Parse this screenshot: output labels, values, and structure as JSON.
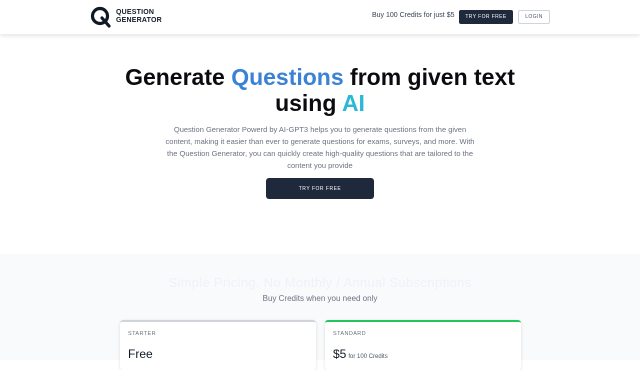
{
  "header": {
    "logo_line1": "QUESTION",
    "logo_line2": "GENERATOR",
    "promo_text": "Buy 100 Credits for just $5",
    "try_label": "TRY FOR FREE",
    "login_label": "LOGIN"
  },
  "hero": {
    "title_part1": "Generate ",
    "title_highlight": "Questions",
    "title_part2": " from given text using ",
    "title_highlight2": "AI",
    "description": "Question Generator Powerd by AI-GPT3 helps you to generate questions from the given content, making it easier than ever to generate questions for exams, surveys, and more. With the Question Generator, you can quickly create high-quality questions that are tailored to the content you provide",
    "cta_label": "TRY FOR FREE"
  },
  "pricing": {
    "title": "Simple Pricing. No Monthly / Annual Subscriptions",
    "subtitle": "Buy Credits when you need only",
    "plans": [
      {
        "name": "STARTER",
        "price": "Free",
        "note": ""
      },
      {
        "name": "STANDARD",
        "price": "$5",
        "note": "for 100 Credits"
      }
    ]
  },
  "colors": {
    "brand_dark": "#1e293b",
    "highlight_blue": "#3a82d6",
    "highlight_cyan": "#2bb8d6",
    "standard_accent": "#22c55e"
  }
}
